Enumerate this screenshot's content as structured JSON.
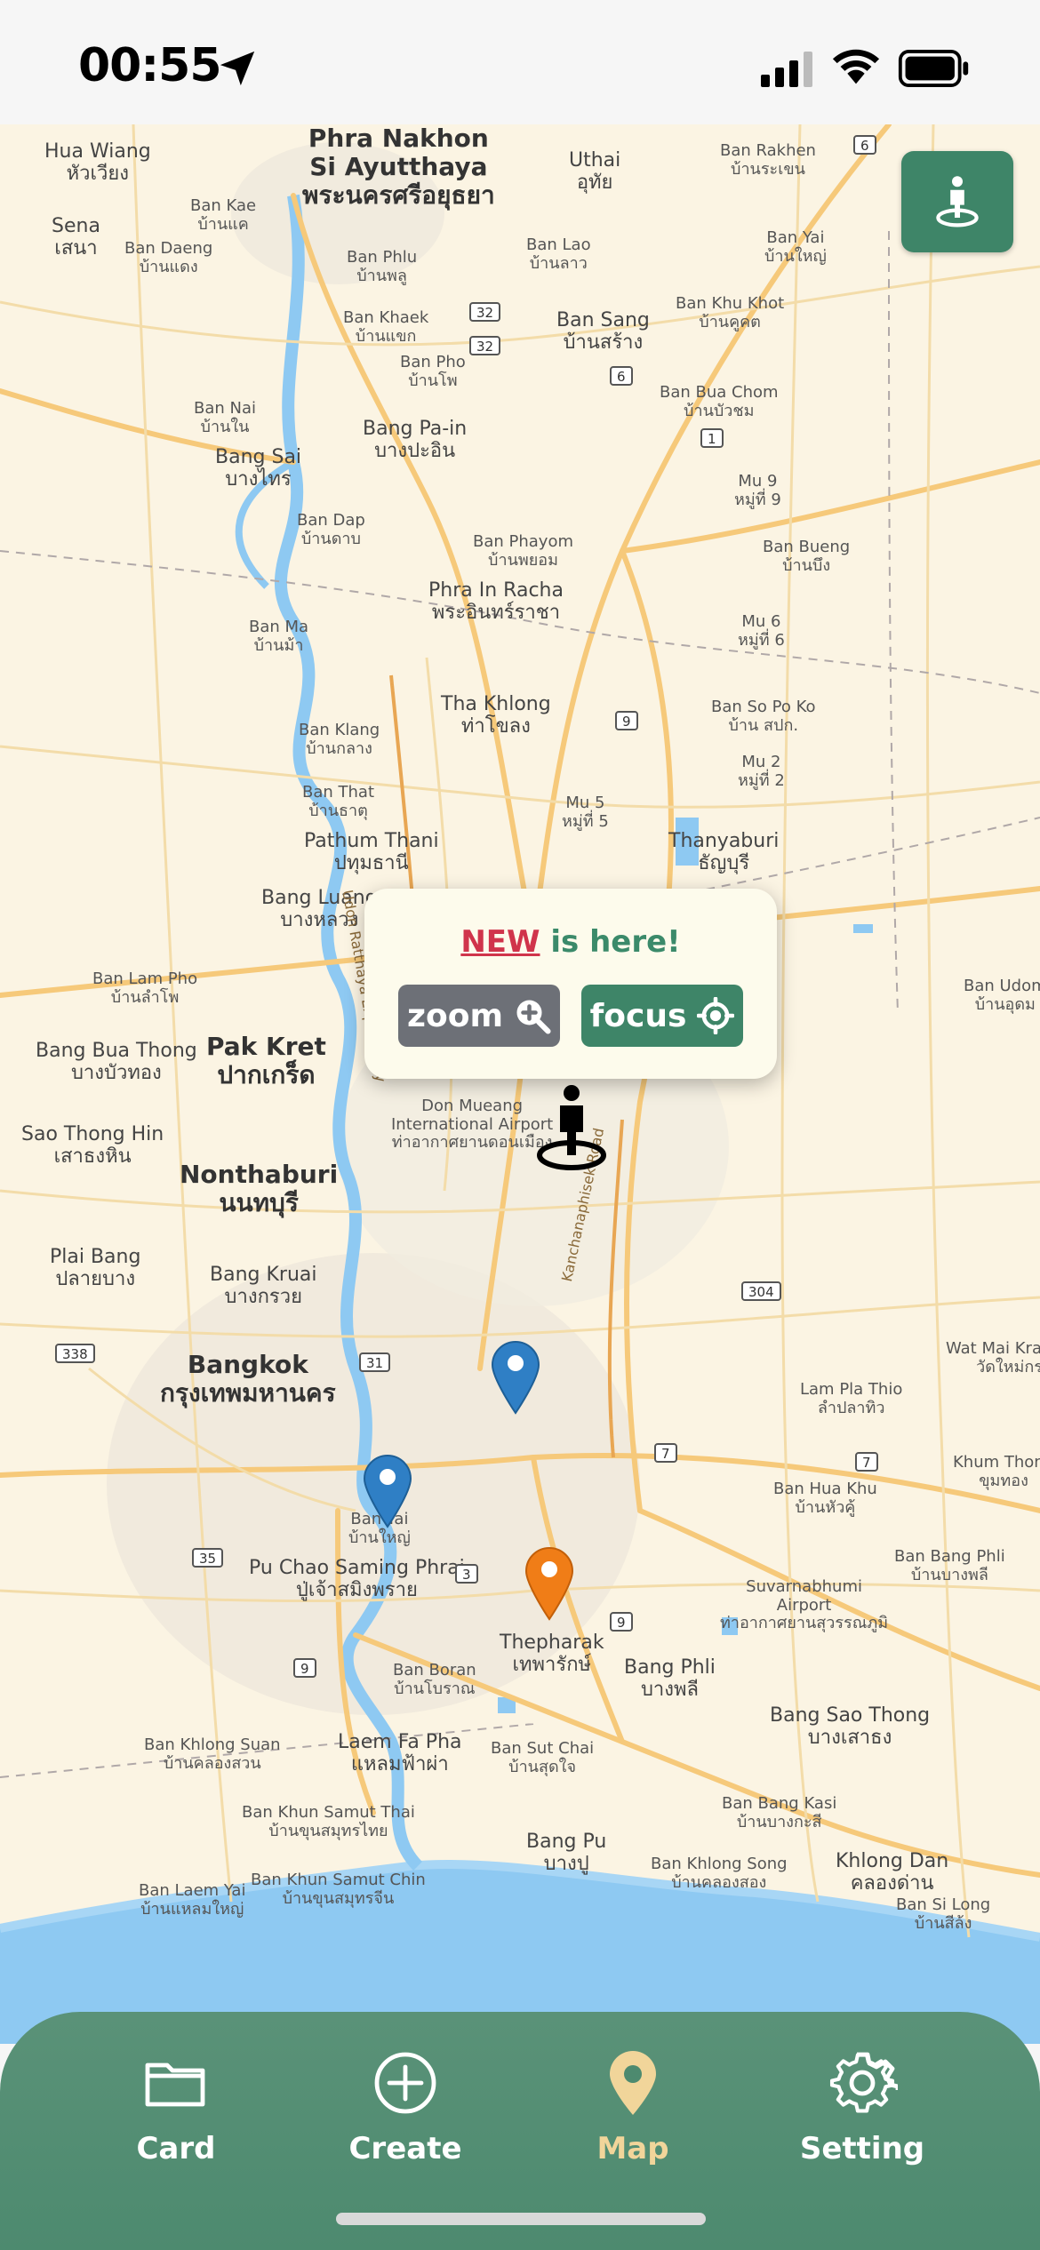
{
  "status_bar": {
    "time": "00:55"
  },
  "map": {
    "labels": [
      {
        "text": "Phra Nakhon\nSi Ayutthaya\nพระนครศรีอยุธยา",
        "cls": "big"
      },
      {
        "text": "Hua Wiang\nหัวเวียง",
        "cls": "mid"
      },
      {
        "text": "Sena\nเสนา",
        "cls": "mid"
      },
      {
        "text": "Ban Kae\nบ้านแค",
        "cls": ""
      },
      {
        "text": "Ban Daeng\nบ้านแดง",
        "cls": ""
      },
      {
        "text": "Uthai\nอุทัย",
        "cls": "mid"
      },
      {
        "text": "Ban Rakhen\nบ้านระเขน",
        "cls": ""
      },
      {
        "text": "Ban Phlu\nบ้านพลู",
        "cls": ""
      },
      {
        "text": "Ban Lao\nบ้านลาว",
        "cls": ""
      },
      {
        "text": "Ban Yai\nบ้านใหญ่",
        "cls": ""
      },
      {
        "text": "Ban Khaek\nบ้านแขก",
        "cls": ""
      },
      {
        "text": "Ban Sang\nบ้านสร้าง",
        "cls": "mid"
      },
      {
        "text": "Ban Khu Khot\nบ้านคูคต",
        "cls": ""
      },
      {
        "text": "Ban Pho\nบ้านโพ",
        "cls": ""
      },
      {
        "text": "Ban Bua Chom\nบ้านบัวชม",
        "cls": ""
      },
      {
        "text": "Ban Nai\nบ้านใน",
        "cls": ""
      },
      {
        "text": "Bang Pa-in\nบางปะอิน",
        "cls": "mid"
      },
      {
        "text": "Bang Sai\nบางไทร",
        "cls": "mid"
      },
      {
        "text": "Mu 9\nหมู่ที่ 9",
        "cls": ""
      },
      {
        "text": "Ban Dap\nบ้านดาบ",
        "cls": ""
      },
      {
        "text": "Ban Phayom\nบ้านพยอม",
        "cls": ""
      },
      {
        "text": "Ban Bueng\nบ้านบึง",
        "cls": ""
      },
      {
        "text": "Phra In Racha\nพระอินทร์ราชา",
        "cls": "mid"
      },
      {
        "text": "Ban Ma\nบ้านม้า",
        "cls": ""
      },
      {
        "text": "Mu 6\nหมู่ที่ 6",
        "cls": ""
      },
      {
        "text": "Tha Khlong\nท่าโขลง",
        "cls": "mid"
      },
      {
        "text": "Ban So Po Ko\nบ้าน สปก.",
        "cls": ""
      },
      {
        "text": "Ban Klang\nบ้านกลาง",
        "cls": ""
      },
      {
        "text": "Mu 2\nหมู่ที่ 2",
        "cls": ""
      },
      {
        "text": "Ban That\nบ้านธาตุ",
        "cls": ""
      },
      {
        "text": "Mu 5\nหมู่ที่ 5",
        "cls": ""
      },
      {
        "text": "Pathum Thani\nปทุมธานี",
        "cls": "mid"
      },
      {
        "text": "Thanyaburi\nธัญบุรี",
        "cls": "mid"
      },
      {
        "text": "Bang Luang\nบางหลวง",
        "cls": "mid"
      },
      {
        "text": "Ban Lam Pho\nบ้านลำโพ",
        "cls": ""
      },
      {
        "text": "Ban Udom\nบ้านอุดม",
        "cls": ""
      },
      {
        "text": "Pak Kret\nปากเกร็ด",
        "cls": "big"
      },
      {
        "text": "Bang Bua Thong\nบางบัวทอง",
        "cls": "mid"
      },
      {
        "text": "Don Mueang\nInternational Airport\nท่าอากาศยานดอนเมือง",
        "cls": ""
      },
      {
        "text": "Sao Thong Hin\nเสาธงหิน",
        "cls": "mid"
      },
      {
        "text": "Nonthaburi\nนนทบุรี",
        "cls": "big"
      },
      {
        "text": "Plai Bang\nปลายบาง",
        "cls": "mid"
      },
      {
        "text": "Bang Kruai\nบางกรวย",
        "cls": "mid"
      },
      {
        "text": "Bangkok\nกรุงเทพมหานคร",
        "cls": "big"
      },
      {
        "text": "Wat Mai Krathum Lom\nวัดใหม่กระทุ่มล้ม",
        "cls": ""
      },
      {
        "text": "Lam Pla Thio\nลำปลาทิว",
        "cls": ""
      },
      {
        "text": "Khum Thong\nขุมทอง",
        "cls": ""
      },
      {
        "text": "Ban Yai\nบ้านใหญ่",
        "cls": ""
      },
      {
        "text": "Ban Hua Khu\nบ้านหัวคู้",
        "cls": ""
      },
      {
        "text": "Pu Chao Saming Phrai\nปู่เจ้าสมิงพราย",
        "cls": "mid"
      },
      {
        "text": "Suvarnabhumi\nAirport\nท่าอากาศยานสุวรรณภูมิ",
        "cls": ""
      },
      {
        "text": "Ban Bang Phli\nบ้านบางพลี",
        "cls": ""
      },
      {
        "text": "Thepharak\nเทพารักษ์",
        "cls": "mid"
      },
      {
        "text": "Bang Phli\nบางพลี",
        "cls": "mid"
      },
      {
        "text": "Ban Boran\nบ้านโบราณ",
        "cls": ""
      },
      {
        "text": "Bang Sao Thong\nบางเสาธง",
        "cls": "mid"
      },
      {
        "text": "Ban Khlong Suan\nบ้านคลองสวน",
        "cls": ""
      },
      {
        "text": "Laem Fa Pha\nแหลมฟ้าผ่า",
        "cls": "mid"
      },
      {
        "text": "Ban Sut Chai\nบ้านสุดใจ",
        "cls": ""
      },
      {
        "text": "Ban Khun Samut Thai\nบ้านขุนสมุทรไทย",
        "cls": ""
      },
      {
        "text": "Ban Bang Kasi\nบ้านบางกะสี",
        "cls": ""
      },
      {
        "text": "Bang Pu\nบางปู",
        "cls": "mid"
      },
      {
        "text": "Ban Khlong Song\nบ้านคลองสอง",
        "cls": ""
      },
      {
        "text": "Khlong Dan\nคลองด่าน",
        "cls": "mid"
      },
      {
        "text": "Ban Khun Samut Chin\nบ้านขุนสมุทรจีน",
        "cls": ""
      },
      {
        "text": "Ban Laem Yai\nบ้านแหลมใหญ่",
        "cls": ""
      },
      {
        "text": "Ban Si Long\nบ้านสีล้ง",
        "cls": ""
      }
    ],
    "route_shields": [
      "6",
      "32",
      "32",
      "6",
      "1",
      "9",
      "304",
      "338",
      "31",
      "7",
      "7",
      "35",
      "3",
      "9",
      "9"
    ],
    "road_names": [
      "Udon Ratthaya Expressway",
      "Kanchanaphisek Road"
    ]
  },
  "popup": {
    "new_label": "NEW",
    "title_rest": " is here!",
    "zoom_label": "zoom",
    "focus_label": "focus"
  },
  "markers": [
    {
      "color": "#2f7fc5"
    },
    {
      "color": "#2f7fc5"
    },
    {
      "color": "#f07d17"
    }
  ],
  "tabs": [
    {
      "label": "Card",
      "icon": "folder-icon",
      "active": false
    },
    {
      "label": "Create",
      "icon": "plus-circle-icon",
      "active": false
    },
    {
      "label": "Map",
      "icon": "map-pin-icon",
      "active": true
    },
    {
      "label": "Setting",
      "icon": "gear-icon",
      "active": false
    }
  ],
  "colors": {
    "accent_green": "#3e8568",
    "tab_active": "#f1d59a",
    "new_red": "#d0344b",
    "map_land": "#fbf4e3",
    "map_water": "#8ec9f2"
  }
}
